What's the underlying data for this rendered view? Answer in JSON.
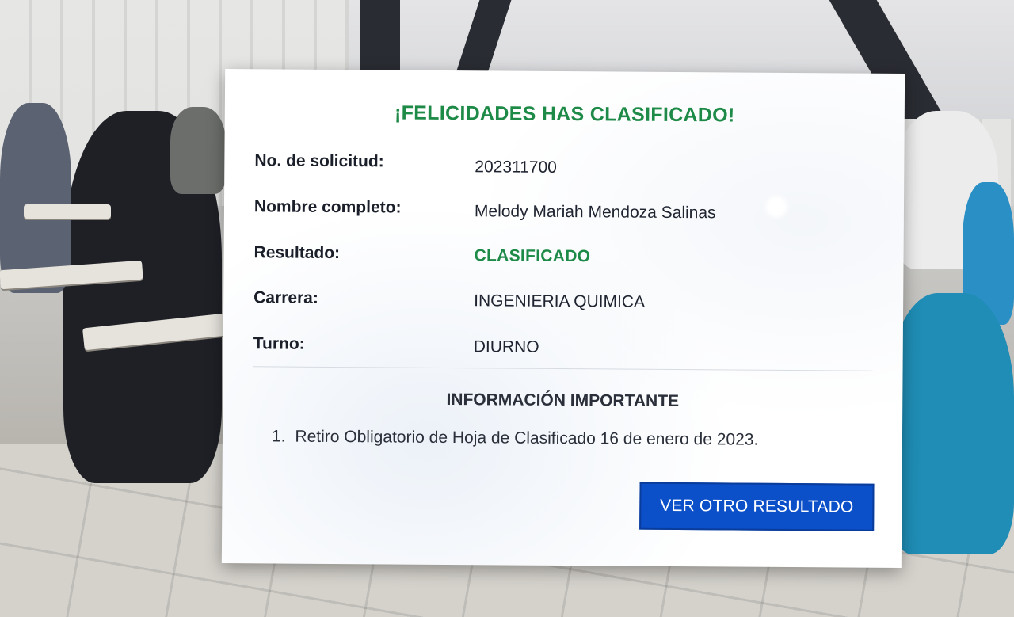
{
  "result_card": {
    "title": "¡FELICIDADES HAS CLASIFICADO!",
    "fields": [
      {
        "label": "No. de solicitud:",
        "value": "202311700"
      },
      {
        "label": "Nombre completo:",
        "value": "Melody Mariah Mendoza Salinas"
      },
      {
        "label": "Resultado:",
        "value": "CLASIFICADO"
      },
      {
        "label": "Carrera:",
        "value": "INGENIERIA QUIMICA"
      },
      {
        "label": "Turno:",
        "value": "DIURNO"
      }
    ],
    "info": {
      "title": "INFORMACIÓN IMPORTANTE",
      "items": [
        {
          "number": "1.",
          "text": "Retiro Obligatorio de Hoja de Clasificado 16 de enero de 2023."
        }
      ]
    },
    "button_label": "VER OTRO RESULTADO"
  },
  "colors": {
    "success_green": "#1e8a47",
    "button_blue": "#0b4fc9"
  }
}
